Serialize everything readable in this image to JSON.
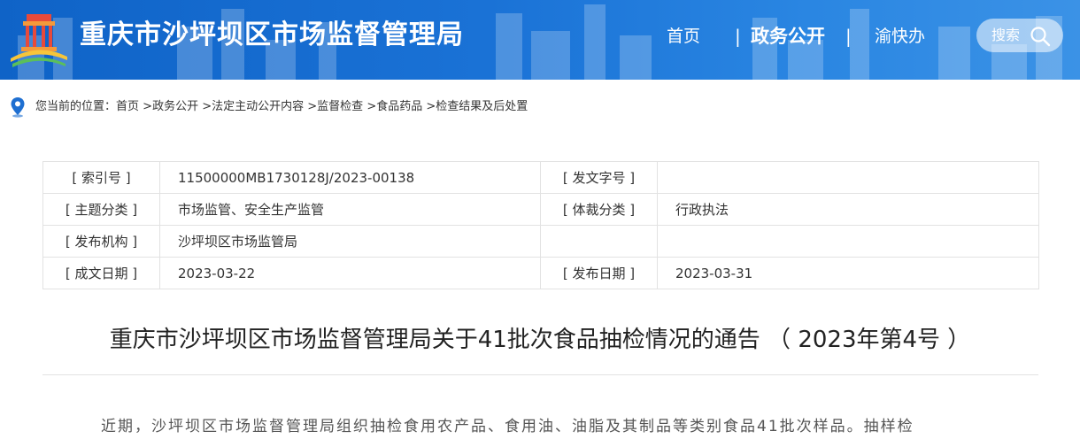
{
  "header": {
    "site_title": "重庆市沙坪坝区市场监督管理局",
    "nav": {
      "home": "首页",
      "separator": "|",
      "gov_affairs": "政务公开",
      "yu_kuai_ban": "渝快办"
    },
    "search_label": "搜索",
    "colors": {
      "header_bg": "#1a72d6",
      "text": "#ffffff"
    }
  },
  "breadcrumb": {
    "prefix": "您当前的位置：",
    "items": [
      "首页",
      ">政务公开",
      ">法定主动公开内容",
      ">监督检查",
      ">食品药品",
      ">检查结果及后处置"
    ]
  },
  "info": {
    "rows": [
      {
        "label1": "[ 索引号 ]",
        "value1": "11500000MB1730128J/2023-00138",
        "label2": "[ 发文字号 ]",
        "value2": ""
      },
      {
        "label1": "[ 主题分类 ]",
        "value1": "市场监管、安全生产监管",
        "label2": "[ 体裁分类 ]",
        "value2": "行政执法"
      },
      {
        "label1": "[ 发布机构 ]",
        "value1": "沙坪坝区市场监管局",
        "label2": "",
        "value2": ""
      },
      {
        "label1": "[ 成文日期 ]",
        "value1": "2023-03-22",
        "label2": "[ 发布日期 ]",
        "value2": "2023-03-31"
      }
    ]
  },
  "article": {
    "title": "重庆市沙坪坝区市场监督管理局关于41批次食品抽检情况的通告 （ 2023年第4号 ）",
    "body_first_line": "近期，沙坪坝区市场监督管理局组织抽检食用农产品、食用油、油脂及其制品等类别食品41批次样品。抽样检"
  }
}
